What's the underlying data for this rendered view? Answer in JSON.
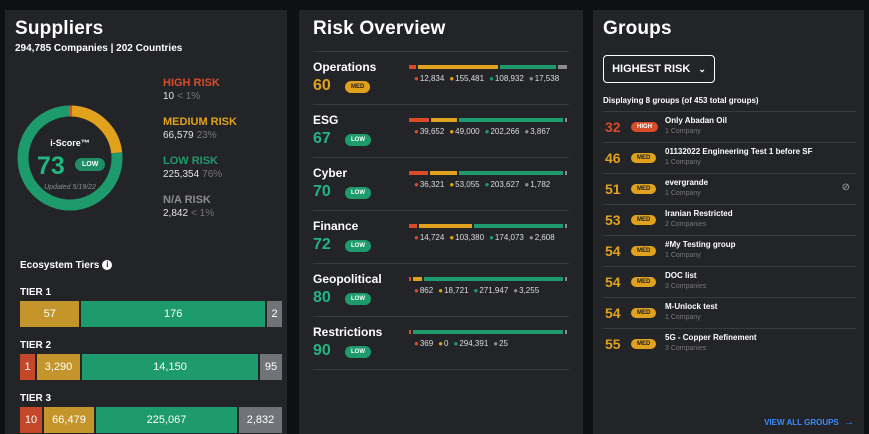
{
  "colors": {
    "high": "#d84c27",
    "medium": "#e0a21d",
    "low": "#1e9b6c",
    "na": "#8c8c90",
    "blue": "#3b8cff"
  },
  "suppliers": {
    "title": "Suppliers",
    "subtitle": "294,785 Companies | 202 Countries",
    "iscore_label": "i-Score™",
    "score": "73",
    "score_pill": "LOW",
    "updated": "Updated 5/19/22",
    "donut": [
      {
        "name": "high",
        "value": 10
      },
      {
        "name": "medium",
        "value": 66579
      },
      {
        "name": "low",
        "value": 225354
      },
      {
        "name": "na",
        "value": 2842
      }
    ],
    "legend": [
      {
        "label": "HIGH RISK",
        "value": "10",
        "pct": "< 1%",
        "color": "#d84c27"
      },
      {
        "label": "MEDIUM RISK",
        "value": "66,579",
        "pct": "23%",
        "color": "#e0a21d"
      },
      {
        "label": "LOW RISK",
        "value": "225,354",
        "pct": "76%",
        "color": "#1e9b6c"
      },
      {
        "label": "N/A RISK",
        "value": "2,842",
        "pct": "< 1%",
        "color": "#8c8c90"
      }
    ],
    "ecosystem_title": "Ecosystem Tiers",
    "tiers": [
      {
        "name": "TIER 1",
        "segments": [
          {
            "label": "57",
            "value": 57,
            "color": "#c4952b"
          },
          {
            "label": "176",
            "value": 176,
            "color": "#1e9b6c"
          },
          {
            "label": "2",
            "value": 2,
            "color": "#707478"
          }
        ]
      },
      {
        "name": "TIER 2",
        "segments": [
          {
            "label": "1",
            "value": 1,
            "color": "#c5472a"
          },
          {
            "label": "3,290",
            "value": 3290,
            "color": "#c4952b"
          },
          {
            "label": "14,150",
            "value": 14150,
            "color": "#1e9b6c"
          },
          {
            "label": "95",
            "value": 95,
            "color": "#707478"
          }
        ]
      },
      {
        "name": "TIER 3",
        "segments": [
          {
            "label": "10",
            "value": 10,
            "color": "#c5472a"
          },
          {
            "label": "66,479",
            "value": 66479,
            "color": "#c4952b"
          },
          {
            "label": "225,067",
            "value": 225067,
            "color": "#1e9b6c"
          },
          {
            "label": "2,832",
            "value": 2832,
            "color": "#707478"
          }
        ]
      }
    ]
  },
  "risk": {
    "title": "Risk Overview",
    "rows": [
      {
        "name": "Operations",
        "score": "60",
        "pill": "MED",
        "pill_color": "#e0a21d",
        "score_color": "#e0a21d",
        "counts": [
          12834,
          155481,
          108932,
          17538
        ],
        "labels": [
          "12,834",
          "155,481",
          "108,932",
          "17,538"
        ]
      },
      {
        "name": "ESG",
        "score": "67",
        "pill": "LOW",
        "pill_color": "#1e9b6c",
        "score_color": "#22b57f",
        "counts": [
          39652,
          49000,
          202266,
          3867
        ],
        "labels": [
          "39,652",
          "49,000",
          "202,266",
          "3,867"
        ]
      },
      {
        "name": "Cyber",
        "score": "70",
        "pill": "LOW",
        "pill_color": "#1e9b6c",
        "score_color": "#22b57f",
        "counts": [
          36321,
          53055,
          203627,
          1782
        ],
        "labels": [
          "36,321",
          "53,055",
          "203,627",
          "1,782"
        ]
      },
      {
        "name": "Finance",
        "score": "72",
        "pill": "LOW",
        "pill_color": "#1e9b6c",
        "score_color": "#22b57f",
        "counts": [
          14724,
          103380,
          174073,
          2608
        ],
        "labels": [
          "14,724",
          "103,380",
          "174,073",
          "2,608"
        ]
      },
      {
        "name": "Geopolitical",
        "score": "80",
        "pill": "LOW",
        "pill_color": "#1e9b6c",
        "score_color": "#22b57f",
        "counts": [
          862,
          18721,
          271947,
          3255
        ],
        "labels": [
          "862",
          "18,721",
          "271,947",
          "3,255"
        ]
      },
      {
        "name": "Restrictions",
        "score": "90",
        "pill": "LOW",
        "pill_color": "#1e9b6c",
        "score_color": "#22b57f",
        "counts": [
          369,
          0,
          294391,
          25
        ],
        "labels": [
          "369",
          "0",
          "294,391",
          "25"
        ]
      }
    ]
  },
  "groups": {
    "title": "Groups",
    "dropdown_label": "HIGHEST RISK",
    "displaying": "Displaying 8 groups (of 453 total groups)",
    "items": [
      {
        "score": "32",
        "pill": "HIGH",
        "pill_color": "#d84c27",
        "score_color": "#d84c27",
        "name": "Only Abadan Oil",
        "count": "1 Company"
      },
      {
        "score": "46",
        "pill": "MED",
        "pill_color": "#e0a21d",
        "score_color": "#e0a21d",
        "name": "01132022 Engineering Test 1 before SF",
        "count": "1 Company"
      },
      {
        "score": "51",
        "pill": "MED",
        "pill_color": "#e0a21d",
        "score_color": "#e0a21d",
        "name": "evergrande",
        "count": "1 Company",
        "hidden_icon": true
      },
      {
        "score": "53",
        "pill": "MED",
        "pill_color": "#e0a21d",
        "score_color": "#e0a21d",
        "name": "Iranian Restricted",
        "count": "2 Companies"
      },
      {
        "score": "54",
        "pill": "MED",
        "pill_color": "#e0a21d",
        "score_color": "#e0a21d",
        "name": "#My Testing group",
        "count": "1 Company"
      },
      {
        "score": "54",
        "pill": "MED",
        "pill_color": "#e0a21d",
        "score_color": "#e0a21d",
        "name": "DOC list",
        "count": "3 Companies"
      },
      {
        "score": "54",
        "pill": "MED",
        "pill_color": "#e0a21d",
        "score_color": "#e0a21d",
        "name": "M-Unlock test",
        "count": "1 Company"
      },
      {
        "score": "55",
        "pill": "MED",
        "pill_color": "#e0a21d",
        "score_color": "#e0a21d",
        "name": "5G - Copper Refinement",
        "count": "3 Companies"
      }
    ],
    "view_all": "VIEW ALL GROUPS"
  }
}
